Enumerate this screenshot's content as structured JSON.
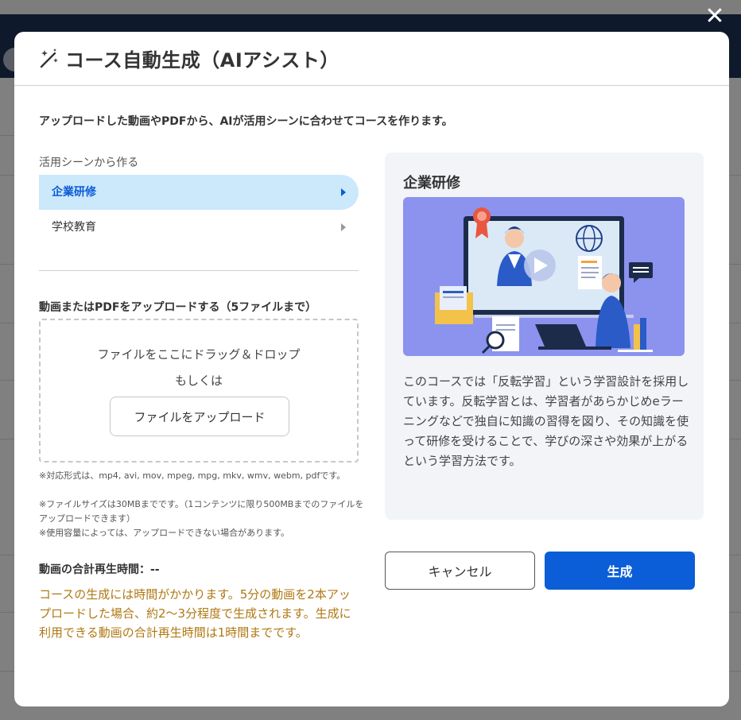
{
  "modal": {
    "title": "コース自動生成（AIアシスト）",
    "intro": "アップロードした動画やPDFから、AIが活用シーンに合わせてコースを作ります。"
  },
  "scenes": {
    "label": "活用シーンから作る",
    "items": [
      {
        "label": "企業研修",
        "active": true
      },
      {
        "label": "学校教育",
        "active": false
      }
    ]
  },
  "upload": {
    "title": "動画またはPDFをアップロードする（5ファイルまで）",
    "drag_text": "ファイルをここにドラッグ＆ドロップ",
    "or_text": "もしくは",
    "button_label": "ファイルをアップロード",
    "notes": [
      "※対応形式は、mp4, avi, mov, mpeg, mpg, mkv, wmv, webm, pdfです。",
      "※ファイルサイズは30MBまでです。（1コンテンツに限り500MBまでのファイルをアップロードできます）",
      "※使用容量によっては、アップロードできない場合があります。"
    ]
  },
  "total_duration": "動画の合計再生時間：--",
  "warning": "コースの生成には時間がかかります。5分の動画を2本アップロードした場合、約2〜3分程度で生成されます。生成に利用できる動画の合計再生時間は1時間までです。",
  "panel": {
    "title": "企業研修",
    "description": "このコースでは「反転学習」という学習設計を採用しています。反転学習とは、学習者があらかじめeラーニングなどで独自に知識の習得を図り、その知識を使って研修を受けることで、学びの深さや効果が上がるという学習方法です。"
  },
  "buttons": {
    "cancel": "キャンセル",
    "generate": "生成"
  },
  "colors": {
    "primary": "#0b5ed7",
    "active_bg": "#cce8fb",
    "warning": "#b07812",
    "illustration_bg": "#8b93ee"
  },
  "icons": {
    "close": "close-icon",
    "title": "magic-wand-icon",
    "chevron": "chevron-right-icon"
  }
}
